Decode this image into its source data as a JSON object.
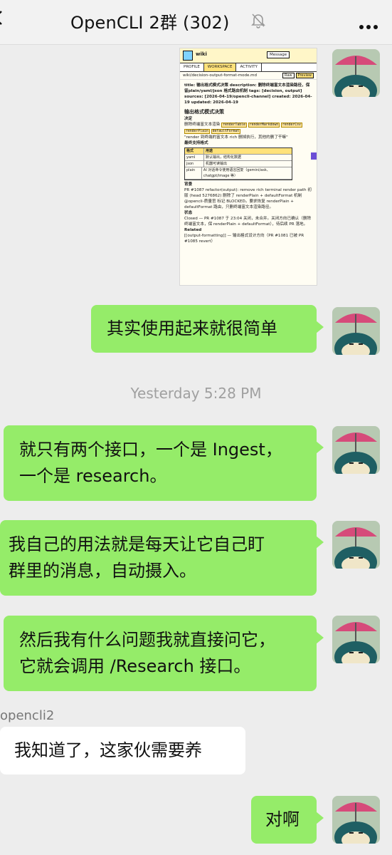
{
  "header": {
    "title": "OpenCLI 2群 (302)",
    "mute_icon": "bell-slash-icon",
    "more_icon": "ellipsis-icon"
  },
  "shared_screenshot": {
    "app_name": "wiki",
    "message_button": "Message",
    "tabs": [
      "PROFILE",
      "WORKSPACE",
      "ACTIVITY"
    ],
    "active_tab": "WORKSPACE",
    "path": "wiki/decision-output-format-mode.md",
    "raw_button": "Raw",
    "preview_button": "Preview",
    "frontmatter": "title: 输出格式模式决策 description: 删除终端富文本渲染路径，保留plain/yaml/json 格式路由机制 tags: [decision, output] sources: [2026-04-19/opencli-channel] created: 2026-04-19 updated: 2026-04-19",
    "heading": "输出格式模式决策",
    "section_decision": "决定",
    "decision_text": "删除终端富文本渲染",
    "chips_decision": [
      "renderTable",
      "renderMarkdown",
      "renderCsv",
      "renderPlain",
      "defaultFormat"
    ],
    "quote": "\"render 到终端的富文本 rich 删掉执行，其他的删了干嘛\"",
    "section_formats": "最终支持格式",
    "table_header": [
      "格式",
      "用途"
    ],
    "table_rows": [
      [
        "yaml",
        "默认输出，结构化数据"
      ],
      [
        "json",
        "机器可读输出"
      ],
      [
        "plain",
        "AI 对话命令使用语言回复（gemini/ask、chatgpt/image 等）"
      ]
    ],
    "section_background": "背景",
    "background_text": "PR #1087 refactor(output): remove rich terminal render path 初版 (head 5276862) 删除了 renderPlain + defaultFormat 机制",
    "background_text2": "@opencli-质量官 标记 BLOCKED。要求恢复 renderPlain + defaultFormat 路由，只删终端富文本渲染路径。",
    "section_status": "状态",
    "status_text": "Closed — PR #1087 于 23:04 关闭，未合并。关闭方向已确认（删除终端富文本，保 renderPlain + defaultFormat），待后续 PR 落地。",
    "section_related": "Related",
    "related_text": "[[output-formatting]] — 输出格式设计方向（PR #1081 已被 PR #1085 revert）"
  },
  "messages": [
    {
      "side": "right",
      "text_lines": [
        "其实使用起来就很简单"
      ]
    },
    {
      "side": "right",
      "text_lines": [
        "就只有两个接口，一个是 Ingest，",
        "一个是 research。"
      ]
    },
    {
      "side": "right",
      "text_lines": [
        "我自己的用法就是每天让它自己盯",
        "群里的消息，自动摄入。"
      ]
    },
    {
      "side": "right",
      "text_lines": [
        "然后我有什么问题我就直接问它，",
        "它就会调用 /Research 接口。"
      ]
    },
    {
      "side": "left",
      "sender": "opencli2",
      "text_lines": [
        "我知道了，这家伙需要养"
      ]
    },
    {
      "side": "right",
      "text_lines": [
        "对啊"
      ]
    }
  ],
  "timestamp": "Yesterday 5:28 PM",
  "colors": {
    "own_bubble": "#95ec69",
    "other_bubble": "#ffffff",
    "background": "#ededed"
  }
}
